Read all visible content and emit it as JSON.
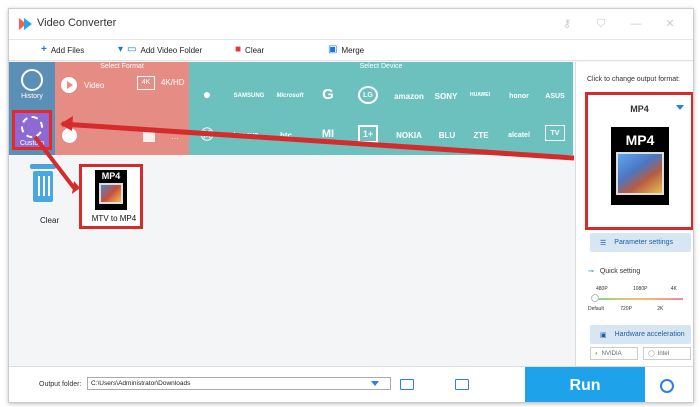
{
  "app": {
    "title": "Video Converter"
  },
  "toolbar": {
    "add_files": "Add Files",
    "add_video_folder": "Add Video Folder",
    "clear": "Clear",
    "merge": "Merge"
  },
  "sidebar": {
    "history": "History",
    "custom": "Custom"
  },
  "formats": {
    "header": "Select Format",
    "video": "Video",
    "hd_badge": "4K",
    "hd_label": "4K/HD"
  },
  "devices": {
    "header": "Select Device",
    "row1": [
      "",
      "SAMSUNG",
      "Microsoft",
      "G",
      "LG",
      "amazon",
      "SONY",
      "HUAWEI",
      "honor",
      "ASUS"
    ],
    "row2": [
      "",
      "Lenovo",
      "htc",
      "MI",
      "1+",
      "NOKIA",
      "BLU",
      "ZTE",
      "alcatel",
      "TV"
    ]
  },
  "workspace": {
    "clear_label": "Clear",
    "mtv_badge": "MP4",
    "mtv_label": "MTV to MP4"
  },
  "right_panel": {
    "change_format": "Click to change output format:",
    "format": "MP4",
    "big_badge": "MP4",
    "parameter_settings": "Parameter settings",
    "quick_setting": "Quick setting",
    "slider_top_labels": [
      "480P",
      "1080P",
      "4K"
    ],
    "slider_bottom_labels": [
      "Default",
      "720P",
      "2K"
    ],
    "slider_value": 0,
    "hardware_acceleration": "Hardware acceleration",
    "nvidia": "NVIDIA",
    "intel": "Intel"
  },
  "bottom": {
    "output_folder_label": "Output folder:",
    "output_folder_value": "C:\\Users\\Administrator\\Downloads",
    "run": "Run"
  },
  "colors": {
    "format_panel": "#e58c85",
    "device_panel": "#6cc1bf",
    "sidebar": "#5b8fb5",
    "custom": "#8d6ad3",
    "accent": "#1ea3ea",
    "annotation": "#d62b2b"
  }
}
